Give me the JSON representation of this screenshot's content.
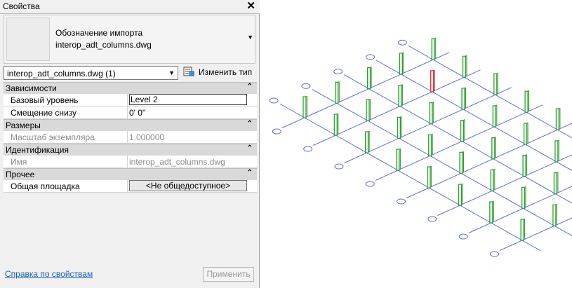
{
  "window": {
    "title": "Свойства"
  },
  "type_selector": {
    "line1": "Обозначение импорта",
    "line2": "interop_adt_columns.dwg"
  },
  "instance_filter": {
    "value": "interop_adt_columns.dwg (1)"
  },
  "edit_type": {
    "label": "Изменить тип"
  },
  "categories": [
    {
      "name": "Зависимости",
      "props": [
        {
          "key": "Базовый уровень",
          "value": "Level 2"
        },
        {
          "key": "Смещение снизу",
          "value": "0'  0\""
        }
      ]
    },
    {
      "name": "Размеры",
      "props": [
        {
          "key": "Масштаб экземпляра",
          "value": "1.000000"
        }
      ]
    },
    {
      "name": "Идентификация",
      "props": [
        {
          "key": "Имя",
          "value": "interop_adt_columns.dwg"
        }
      ]
    },
    {
      "name": "Прочее",
      "props": [
        {
          "key": "Общая площадка",
          "value": "<Не общедоступное>"
        }
      ]
    }
  ],
  "footer": {
    "help_link": "Справка по свойствам",
    "apply_label": "Применить"
  },
  "colors": {
    "grid_line": "#5b6fe0",
    "column_green": "#2d9c2d",
    "column_selected": "#e02020"
  }
}
